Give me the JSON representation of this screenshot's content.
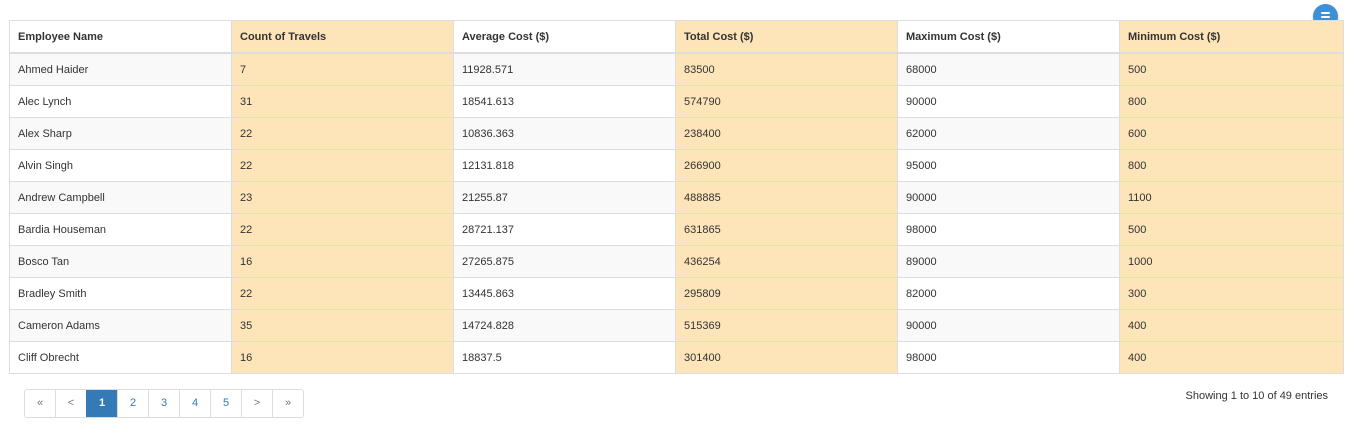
{
  "table": {
    "columns": [
      {
        "label": "Employee Name",
        "highlight": false
      },
      {
        "label": "Count of Travels",
        "highlight": true
      },
      {
        "label": "Average Cost ($)",
        "highlight": false
      },
      {
        "label": "Total Cost ($)",
        "highlight": true
      },
      {
        "label": "Maximum Cost ($)",
        "highlight": false
      },
      {
        "label": "Minimum Cost ($)",
        "highlight": true
      }
    ],
    "rows": [
      [
        "Ahmed Haider",
        "7",
        "11928.571",
        "83500",
        "68000",
        "500"
      ],
      [
        "Alec Lynch",
        "31",
        "18541.613",
        "574790",
        "90000",
        "800"
      ],
      [
        "Alex Sharp",
        "22",
        "10836.363",
        "238400",
        "62000",
        "600"
      ],
      [
        "Alvin Singh",
        "22",
        "12131.818",
        "266900",
        "95000",
        "800"
      ],
      [
        "Andrew Campbell",
        "23",
        "21255.87",
        "488885",
        "90000",
        "1100"
      ],
      [
        "Bardia Houseman",
        "22",
        "28721.137",
        "631865",
        "98000",
        "500"
      ],
      [
        "Bosco Tan",
        "16",
        "27265.875",
        "436254",
        "89000",
        "1000"
      ],
      [
        "Bradley Smith",
        "22",
        "13445.863",
        "295809",
        "82000",
        "300"
      ],
      [
        "Cameron Adams",
        "35",
        "14724.828",
        "515369",
        "90000",
        "400"
      ],
      [
        "Cliff Obrecht",
        "16",
        "18837.5",
        "301400",
        "98000",
        "400"
      ]
    ]
  },
  "pagination": {
    "items": [
      {
        "label": "«",
        "kind": "first"
      },
      {
        "label": "<",
        "kind": "prev"
      },
      {
        "label": "1",
        "kind": "page",
        "active": true
      },
      {
        "label": "2",
        "kind": "page"
      },
      {
        "label": "3",
        "kind": "page"
      },
      {
        "label": "4",
        "kind": "page"
      },
      {
        "label": "5",
        "kind": "page"
      },
      {
        "label": ">",
        "kind": "next"
      },
      {
        "label": "»",
        "kind": "last"
      }
    ]
  },
  "info": {
    "text": "Showing 1 to 10 of 49 entries"
  },
  "menu": {
    "icon": "menu-icon",
    "color": "#3d8fd6"
  },
  "colors": {
    "highlight_column": "#fde4b9",
    "active_page": "#337ab7",
    "link": "#337ab7"
  }
}
